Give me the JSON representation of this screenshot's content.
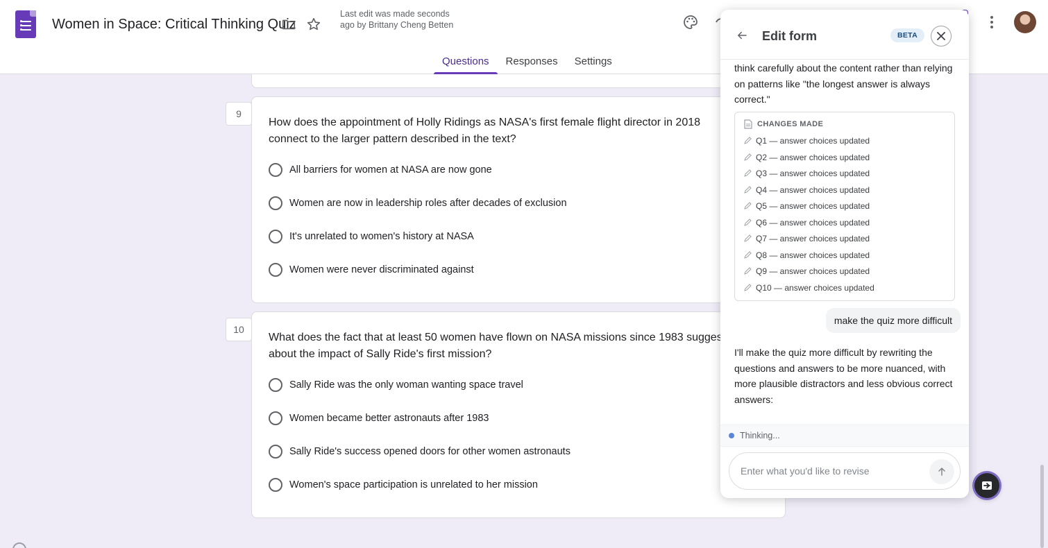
{
  "header": {
    "title": "Women in Space: Critical Thinking Quiz",
    "last_edit": "Last edit was made seconds ago by Brittany Cheng Betten",
    "tabs": [
      "Questions",
      "Responses",
      "Settings"
    ],
    "active_tab": "Questions"
  },
  "questions": [
    {
      "number": "9",
      "text": "How does the appointment of Holly Ridings as NASA's first female flight director in 2018 connect to the larger pattern described in the text?",
      "options": [
        "All barriers for women at NASA are now gone",
        "Women are now in leadership roles after decades of exclusion",
        "It's unrelated to women's history at NASA",
        "Women were never discriminated against"
      ]
    },
    {
      "number": "10",
      "text_line1": "What does the fact that at least 50 women have flown on NASA missions since 1983 sugges",
      "text_line2": "about the impact of Sally Ride's first mission?",
      "options": [
        "Sally Ride was the only woman wanting space travel",
        "Women became better astronauts after 1983",
        "Sally Ride's success opened doors for other women astronauts",
        "Women's space participation is unrelated to her mission"
      ]
    }
  ],
  "panel": {
    "title": "Edit form",
    "badge": "BETA",
    "intro_text": "think carefully about the content rather than relying on patterns like \"the longest answer is always correct.\"",
    "changes_label": "CHANGES MADE",
    "changes": [
      "Q1 — answer choices updated",
      "Q2 — answer choices updated",
      "Q3 — answer choices updated",
      "Q4 — answer choices updated",
      "Q5 — answer choices updated",
      "Q6 — answer choices updated",
      "Q7 — answer choices updated",
      "Q8 — answer choices updated",
      "Q9 — answer choices updated",
      "Q10 — answer choices updated"
    ],
    "user_message": "make the quiz more difficult",
    "assistant_message": "I'll make the quiz more difficult by rewriting the questions and answers to be more nuanced, with more plausible distractors and less obvious correct answers:",
    "status": "Thinking...",
    "input_placeholder": "Enter what you'd like to revise"
  },
  "colors": {
    "accent": "#673ab7",
    "background": "#efebf7",
    "thinking_dot": "#5b86d6"
  }
}
